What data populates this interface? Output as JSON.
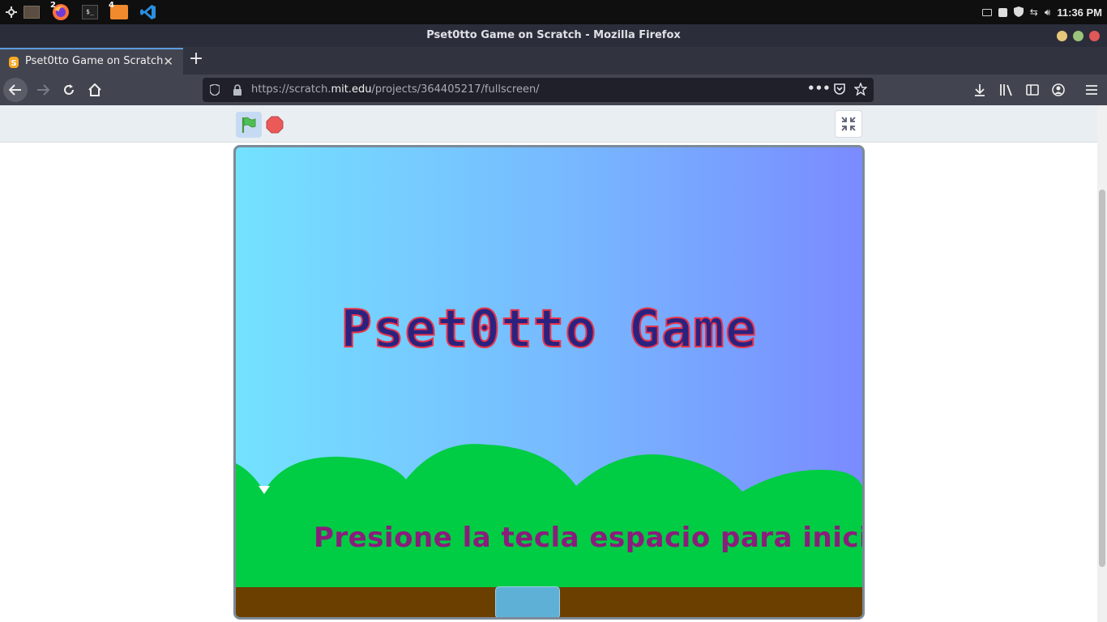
{
  "taskbar": {
    "apps": [
      {
        "name": "settings",
        "badge": ""
      },
      {
        "name": "file-manager",
        "badge": ""
      },
      {
        "name": "firefox",
        "badge": "2"
      },
      {
        "name": "terminal",
        "badge": ""
      },
      {
        "name": "files",
        "badge": "4"
      },
      {
        "name": "vscode",
        "badge": ""
      }
    ],
    "clock": "11:36 PM"
  },
  "window": {
    "title": "Pset0tto Game on Scratch - Mozilla Firefox"
  },
  "browser": {
    "tab_title": "Pset0tto Game on Scratch",
    "url_prefix": "https://scratch.",
    "url_domain": "mit.edu",
    "url_path": "/projects/364405217/fullscreen/"
  },
  "stage": {
    "title": "Pset0tto Game",
    "prompt": "Presione la tecla espacio para iniciar..."
  },
  "colors": {
    "flag": "#4cbf56",
    "stop": "#ec5959",
    "hills": "#00cc44",
    "ground": "#6b3f00"
  }
}
